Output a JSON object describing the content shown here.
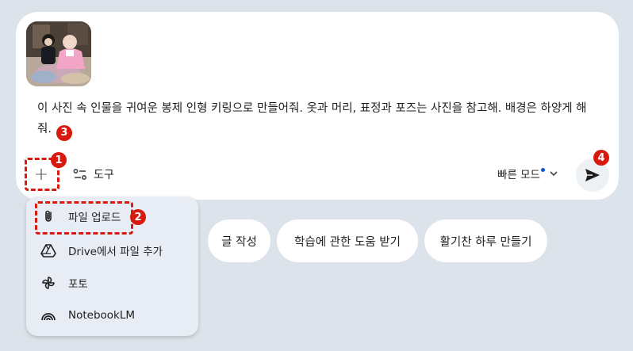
{
  "prompt": {
    "text": "이 사진 속 인물을 귀여운 봉제 인형 키링으로 만들어줘. 옷과 머리, 표정과 포즈는 사진을 참고해. 배경은 하양게 해줘."
  },
  "badges": {
    "b1": "1",
    "b2": "2",
    "b3": "3",
    "b4": "4"
  },
  "toolbar": {
    "plus_label": "+",
    "tools_label": "도구",
    "mode_label": "빠른 모드",
    "mode_chevron": "⌄"
  },
  "menu": {
    "items": [
      {
        "label": "파일 업로드",
        "icon": "paperclip-icon"
      },
      {
        "label": "Drive에서 파일 추가",
        "icon": "drive-icon"
      },
      {
        "label": "포토",
        "icon": "photos-pinwheel-icon"
      },
      {
        "label": "NotebookLM",
        "icon": "notebooklm-icon"
      }
    ]
  },
  "chips": [
    {
      "label": "글 작성"
    },
    {
      "label": "학습에 관한 도움 받기"
    },
    {
      "label": "활기찬 하루 만들기"
    }
  ],
  "colors": {
    "page_background": "#dde3ea",
    "card": "#ffffff",
    "menu": "#e8ecf4",
    "annotation_red": "#d81a0e",
    "mode_dot_blue": "#0b57d0"
  }
}
